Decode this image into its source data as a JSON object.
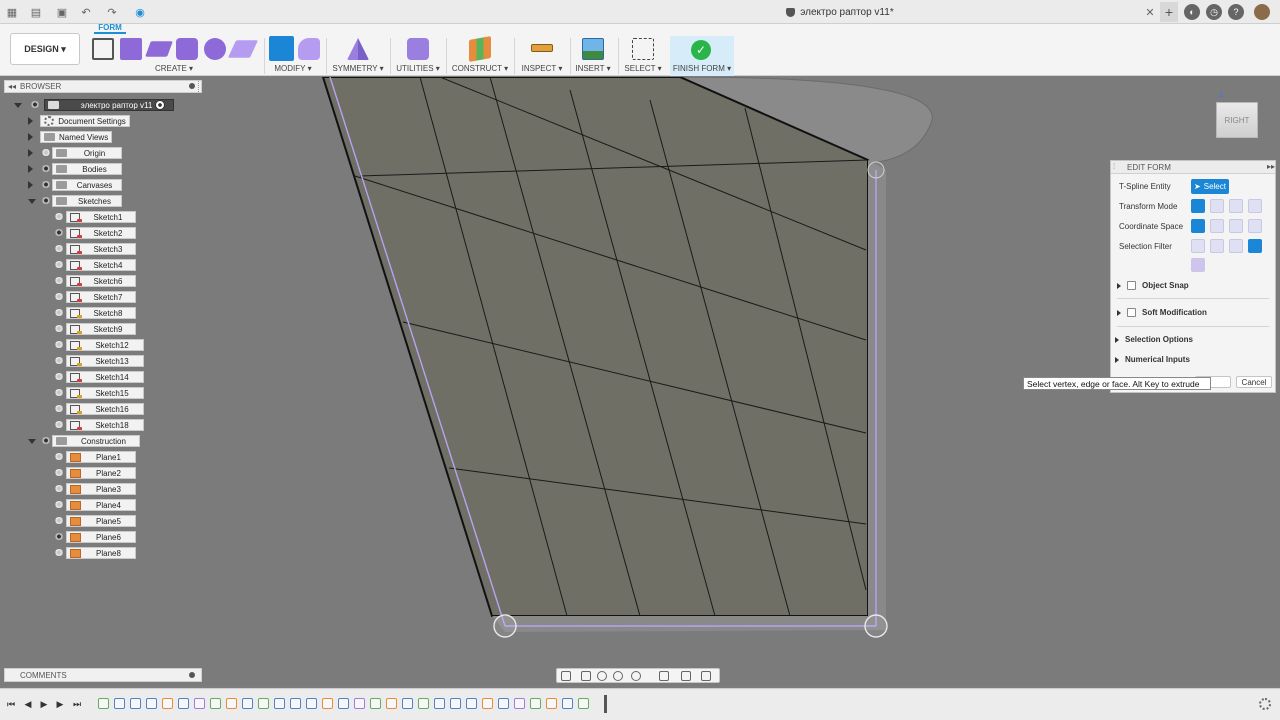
{
  "app": {
    "document_title": "электро раптор v11*"
  },
  "ribbon": {
    "workspace_button": "DESIGN ▾",
    "active_tab": "FORM",
    "groups": [
      {
        "label": "CREATE ▾"
      },
      {
        "label": "MODIFY ▾"
      },
      {
        "label": "SYMMETRY ▾"
      },
      {
        "label": "UTILITIES ▾"
      },
      {
        "label": "CONSTRUCT ▾"
      },
      {
        "label": "INSPECT ▾"
      },
      {
        "label": "INSERT ▾"
      },
      {
        "label": "SELECT ▾"
      },
      {
        "label": "FINISH FORM ▾"
      }
    ]
  },
  "browser": {
    "title": "BROWSER",
    "root": "электро раптор v11",
    "items": [
      {
        "label": "Document Settings",
        "icon": "gear-icon"
      },
      {
        "label": "Named Views",
        "icon": "folder-icon"
      },
      {
        "label": "Origin",
        "icon": "folder-icon"
      },
      {
        "label": "Bodies",
        "icon": "folder-icon"
      },
      {
        "label": "Canvases",
        "icon": "folder-icon"
      },
      {
        "label": "Sketches",
        "icon": "folder-icon"
      }
    ],
    "sketches": [
      "Sketch1",
      "Sketch2",
      "Sketch3",
      "Sketch4",
      "Sketch6",
      "Sketch7",
      "Sketch8",
      "Sketch9",
      "Sketch12",
      "Sketch13",
      "Sketch14",
      "Sketch15",
      "Sketch16",
      "Sketch18"
    ],
    "construction_label": "Construction",
    "planes": [
      "Plane1",
      "Plane2",
      "Plane3",
      "Plane4",
      "Plane5",
      "Plane6",
      "Plane8"
    ]
  },
  "comments": {
    "title": "COMMENTS"
  },
  "viewcube": {
    "face": "RIGHT",
    "axis": "Z"
  },
  "edit_form": {
    "title": "EDIT FORM",
    "rows": {
      "tspline_entity": "T-Spline Entity",
      "transform_mode": "Transform Mode",
      "coordinate_space": "Coordinate Space",
      "selection_filter": "Selection Filter"
    },
    "select_button": "Select",
    "sections": {
      "object_snap": "Object Snap",
      "soft_modification": "Soft Modification",
      "selection_options": "Selection Options",
      "numerical_inputs": "Numerical Inputs"
    },
    "cancel": "Cancel"
  },
  "tooltip": "Select vertex, edge or face. Alt Key to extrude",
  "colors": {
    "accent": "#1c86d6",
    "form_purple": "#8d6ad8",
    "finish_green": "#2ab54a",
    "viewport_bg": "#7b7b7b"
  }
}
